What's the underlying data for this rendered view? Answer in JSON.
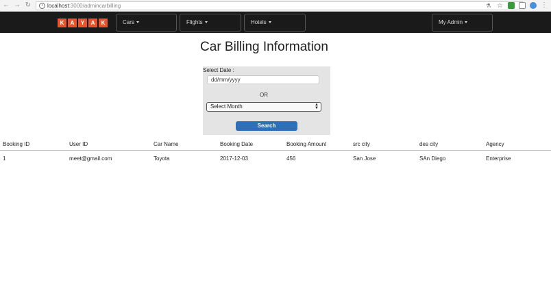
{
  "browser": {
    "url_host": "localhost",
    "url_path": ":3000/admincarbilling"
  },
  "navbar": {
    "logo_letters": [
      "K",
      "A",
      "Y",
      "A",
      "K"
    ],
    "menus": [
      "Cars",
      "Flights",
      "Hotels"
    ],
    "admin_menu": "My Admin"
  },
  "page": {
    "title": "Car Billing Information"
  },
  "form": {
    "date_label": "Select Date :",
    "date_placeholder": "dd/mm/yyyy",
    "or_text": "OR",
    "month_selected": "Select Month",
    "search_label": "Search"
  },
  "table": {
    "columns": [
      "Booking ID",
      "User ID",
      "Car Name",
      "Booking Date",
      "Booking Amount",
      "src city",
      "des city",
      "Agency"
    ],
    "rows": [
      [
        "1",
        "meet@gmail.com",
        "Toyota",
        "2017-12-03",
        "456",
        "San Jose",
        "SAn Diego",
        "Enterprise"
      ]
    ]
  },
  "colors": {
    "navbar_bg": "#1a1a1a",
    "logo_orange": "#e8552b",
    "button_blue": "#2e6fb8",
    "form_panel_bg": "#e4e4e4"
  }
}
